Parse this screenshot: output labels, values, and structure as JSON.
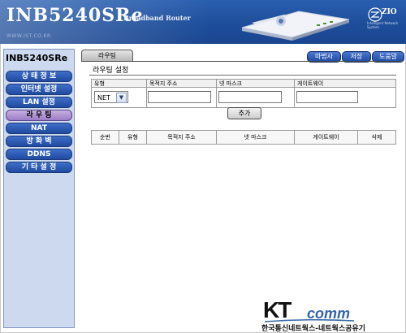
{
  "header": {
    "brand_main": "INB5240SR",
    "brand_suffix": "e",
    "brand_sub": "Broadband Router",
    "brand_url": "WWW.IST.CO.KR",
    "zio_logo": "ZIO",
    "zio_tagline": "Intelligent Network System"
  },
  "sidebar": {
    "model": "INB5240SRe",
    "items": [
      {
        "label": "상 태 정 보",
        "active": false
      },
      {
        "label": "인터넷 설정",
        "active": false
      },
      {
        "label": "LAN 설정",
        "active": false
      },
      {
        "label": "라 우 팅",
        "active": true
      },
      {
        "label": "NAT",
        "active": false
      },
      {
        "label": "방 화 벽",
        "active": false
      },
      {
        "label": "DDNS",
        "active": false
      },
      {
        "label": "기 타 설 정",
        "active": false
      }
    ]
  },
  "content": {
    "tab_label": "라우팅",
    "top_buttons": [
      "마법사",
      "저장",
      "도움말"
    ],
    "section_title": "라우팅 설정",
    "form_headers": [
      "유형",
      "목적지 주소",
      "넷 마스크",
      "게이트웨이"
    ],
    "type_value": "NET",
    "add_button": "추가",
    "list_headers": [
      "순번",
      "유형",
      "목적지 주소",
      "넷 마스크",
      "게이트웨이",
      "삭제"
    ]
  },
  "footer": {
    "logo_kt": "KT",
    "logo_comm": "comm",
    "caption": "한국통신네트웍스-네트웍스공유기"
  },
  "colors": {
    "header_blue": "#1e4f9c",
    "menu_blue": "#1f4aa0",
    "menu_active": "#9c7cc7",
    "sidebar_bg": "#ccd9ee",
    "kt_comm_blue": "#3567a8"
  },
  "icons": {
    "dropdown_arrow": "chevron-down-icon",
    "router_image": "router-image",
    "zio_logo": "zio-logo-icon"
  }
}
